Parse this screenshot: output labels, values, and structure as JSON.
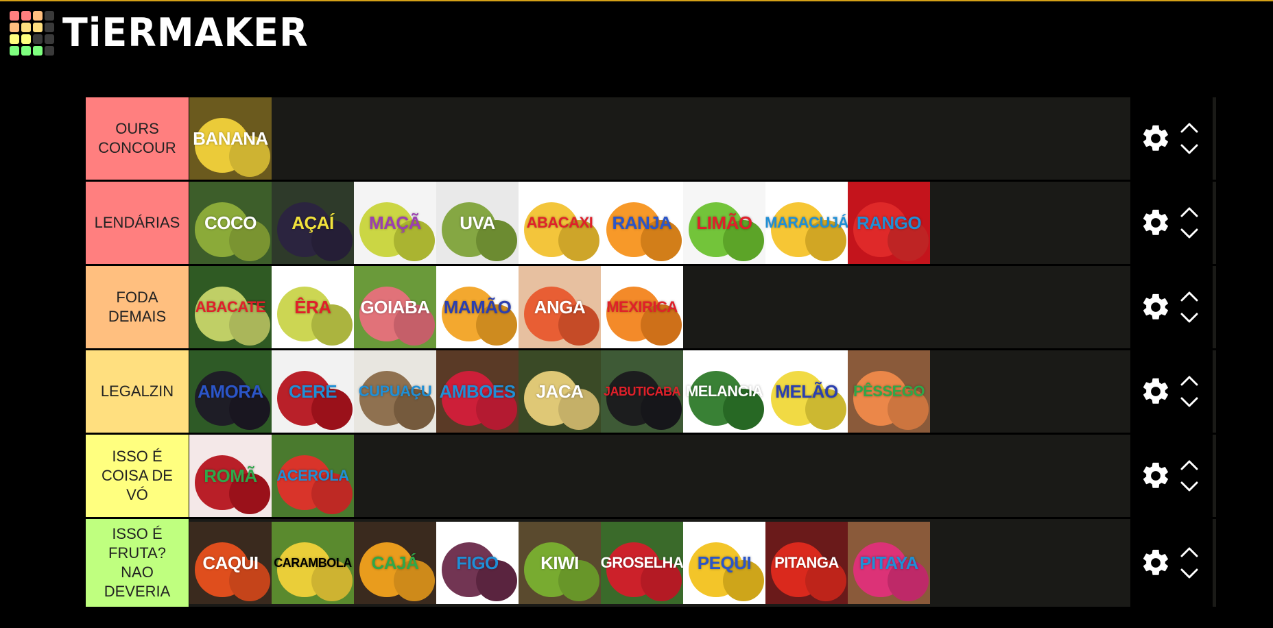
{
  "header": {
    "logo_text": "TiERMAKER",
    "logo_colors": [
      "#ff7f7f",
      "#ff7f7f",
      "#ffbf7f",
      "#3a3a3a",
      "#ffbf7f",
      "#ffdf7f",
      "#ffdf7f",
      "#3a3a3a",
      "#ffff7f",
      "#ffff7f",
      "#3a3a3a",
      "#3a3a3a",
      "#7fff7f",
      "#7fff7f",
      "#7fff7f",
      "#3a3a3a"
    ]
  },
  "tiers": [
    {
      "label": "OURS\nCONCOUR",
      "color": "#ff7f7f",
      "items": [
        {
          "name": "BANANA",
          "bg": "#6b5a1e",
          "fruit": "#f2d23b",
          "text_color": "#ffffff"
        }
      ]
    },
    {
      "label": "LENDÁRIAS",
      "color": "#ff7f7f",
      "items": [
        {
          "name": "COCO",
          "bg": "#3d5e2a",
          "fruit": "#8fae3a",
          "text_color": "#ffffff"
        },
        {
          "name": "AÇAÍ",
          "bg": "#2e3a2a",
          "fruit": "#2b2340",
          "text_color": "#f2e23b"
        },
        {
          "name": "MAÇÃ",
          "bg": "#f4f4f4",
          "fruit": "#c8d43a",
          "text_color": "#9b3fb0"
        },
        {
          "name": "UVA",
          "bg": "#e9e9e9",
          "fruit": "#7fa33a",
          "text_color": "#ffffff"
        },
        {
          "name": "ABACAXI",
          "bg": "#ffffff",
          "fruit": "#f2c230",
          "text_color": "#e0202a"
        },
        {
          "name": "RANJA",
          "bg": "#ffffff",
          "fruit": "#f7941d",
          "text_color": "#2b55c8"
        },
        {
          "name": "LIMÃO",
          "bg": "#f6f6f6",
          "fruit": "#6cc12f",
          "text_color": "#e0202a"
        },
        {
          "name": "MARACUJÁ",
          "bg": "#ffffff",
          "fruit": "#f6c32a",
          "text_color": "#1f8fd6"
        },
        {
          "name": "RANGO",
          "bg": "#c4141c",
          "fruit": "#e02a2a",
          "text_color": "#1f8fd6"
        }
      ]
    },
    {
      "label": "FODA\nDEMAIS",
      "color": "#ffbf7f",
      "items": [
        {
          "name": "ABACATE",
          "bg": "#2f5a23",
          "fruit": "#c8d66a",
          "text_color": "#e0202a"
        },
        {
          "name": "ÊRA",
          "bg": "#ffffff",
          "fruit": "#c9d44a",
          "text_color": "#e0202a"
        },
        {
          "name": "GOIABA",
          "bg": "#6a9a3a",
          "fruit": "#e8707c",
          "text_color": "#ffffff"
        },
        {
          "name": "MAMÃO",
          "bg": "#ffffff",
          "fruit": "#f2a324",
          "text_color": "#2b3fb0"
        },
        {
          "name": "ANGA",
          "bg": "#e7c0a0",
          "fruit": "#e8582e",
          "text_color": "#ffffff"
        },
        {
          "name": "MEXIRICA",
          "bg": "#ffffff",
          "fruit": "#f2841d",
          "text_color": "#e0202a"
        }
      ]
    },
    {
      "label": "LEGALZIN",
      "color": "#ffdf7f",
      "items": [
        {
          "name": "AMORA",
          "bg": "#2e5a26",
          "fruit": "#1d1a26",
          "text_color": "#2b55c8"
        },
        {
          "name": "CERE",
          "bg": "#f2f2f2",
          "fruit": "#b5141e",
          "text_color": "#1f8fd6"
        },
        {
          "name": "CUPUAÇU",
          "bg": "#e8e6e0",
          "fruit": "#8a6a48",
          "text_color": "#1f8fd6"
        },
        {
          "name": "AMBOES",
          "bg": "#5a3a26",
          "fruit": "#d41e3a",
          "text_color": "#1f8fd6"
        },
        {
          "name": "JACA",
          "bg": "#3a4a26",
          "fruit": "#e8cf7a",
          "text_color": "#ffffff"
        },
        {
          "name": "JABUTICABA",
          "bg": "#3e5a36",
          "fruit": "#1a1a1e",
          "text_color": "#e0202a"
        },
        {
          "name": "MELANCIA",
          "bg": "#ffffff",
          "fruit": "#2e7a2a",
          "text_color": "#ffffff"
        },
        {
          "name": "MELÃO",
          "bg": "#ffffff",
          "fruit": "#f0d83a",
          "text_color": "#2b3fb0"
        },
        {
          "name": "PÊSSEGO",
          "bg": "#8a5a3a",
          "fruit": "#f08a4a",
          "text_color": "#2ea84a"
        }
      ]
    },
    {
      "label": "ISSO É\nCOISA DE\nVÓ",
      "color": "#ffff7f",
      "items": [
        {
          "name": "ROMÃ",
          "bg": "#f4e8e8",
          "fruit": "#b5141e",
          "text_color": "#2ea84a"
        },
        {
          "name": "ACEROLA",
          "bg": "#4a7a2e",
          "fruit": "#e0302a",
          "text_color": "#1f8fd6"
        }
      ]
    },
    {
      "label": "ISSO É\nFRUTA?\nNAO\nDEVERIA",
      "color": "#bfff7f",
      "items": [
        {
          "name": "CAQUI",
          "bg": "#3a2a1e",
          "fruit": "#e8501e",
          "text_color": "#ffffff"
        },
        {
          "name": "CARAMBOLA",
          "bg": "#5a8a2e",
          "fruit": "#f2d23a",
          "text_color": "#000000"
        },
        {
          "name": "CAJÁ",
          "bg": "#3a2a1e",
          "fruit": "#f2a21e",
          "text_color": "#2ea84a"
        },
        {
          "name": "FIGO",
          "bg": "#ffffff",
          "fruit": "#6a2a4a",
          "text_color": "#1f8fd6"
        },
        {
          "name": "KIWI",
          "bg": "#5a4a2e",
          "fruit": "#7ab030",
          "text_color": "#ffffff"
        },
        {
          "name": "GROSELHA",
          "bg": "#3a6a2a",
          "fruit": "#d41e2a",
          "text_color": "#ffffff"
        },
        {
          "name": "PEQUI",
          "bg": "#ffffff",
          "fruit": "#f2c21e",
          "text_color": "#2b55c8"
        },
        {
          "name": "PITANGA",
          "bg": "#6a1a1a",
          "fruit": "#e02a1e",
          "text_color": "#ffffff"
        },
        {
          "name": "PITAYA",
          "bg": "#8a5a3a",
          "fruit": "#e0307a",
          "text_color": "#1f8fd6"
        }
      ]
    }
  ]
}
